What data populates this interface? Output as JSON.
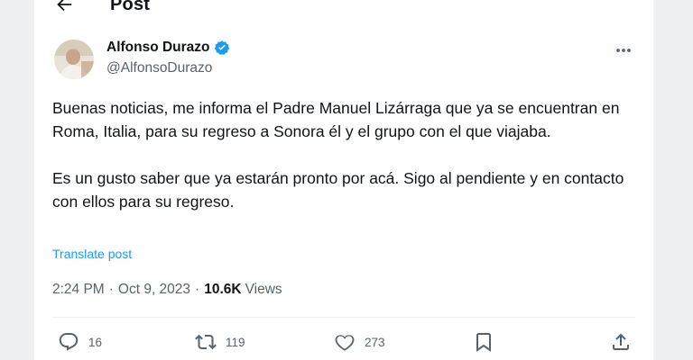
{
  "header": {
    "title": "Post",
    "back_icon": "arrow-left-icon"
  },
  "author": {
    "name": "Alfonso Durazo",
    "handle": "@AlfonsoDurazo",
    "verified_icon": "verified-badge-icon",
    "verified_color": "#1d9bf0"
  },
  "tweet": {
    "paragraph1": "Buenas noticias, me informa el Padre Manuel Lizárraga que ya se encuentran en Roma, Italia, para su regreso a Sonora él y el grupo con el que viajaba.",
    "paragraph2": "Es un gusto saber que ya estarán pronto por acá. Sigo al pendiente y en contacto con ellos para su regreso."
  },
  "translate_label": "Translate post",
  "meta": {
    "time": "2:24 PM",
    "separator": "·",
    "date": "Oct 9, 2023",
    "views_count": "10.6K",
    "views_label": "Views"
  },
  "actions": {
    "reply_count": "16",
    "repost_count": "119",
    "like_count": "273"
  },
  "colors": {
    "accent": "#1d9bf0",
    "secondary_text": "#536471",
    "primary_text": "#0f1419"
  }
}
